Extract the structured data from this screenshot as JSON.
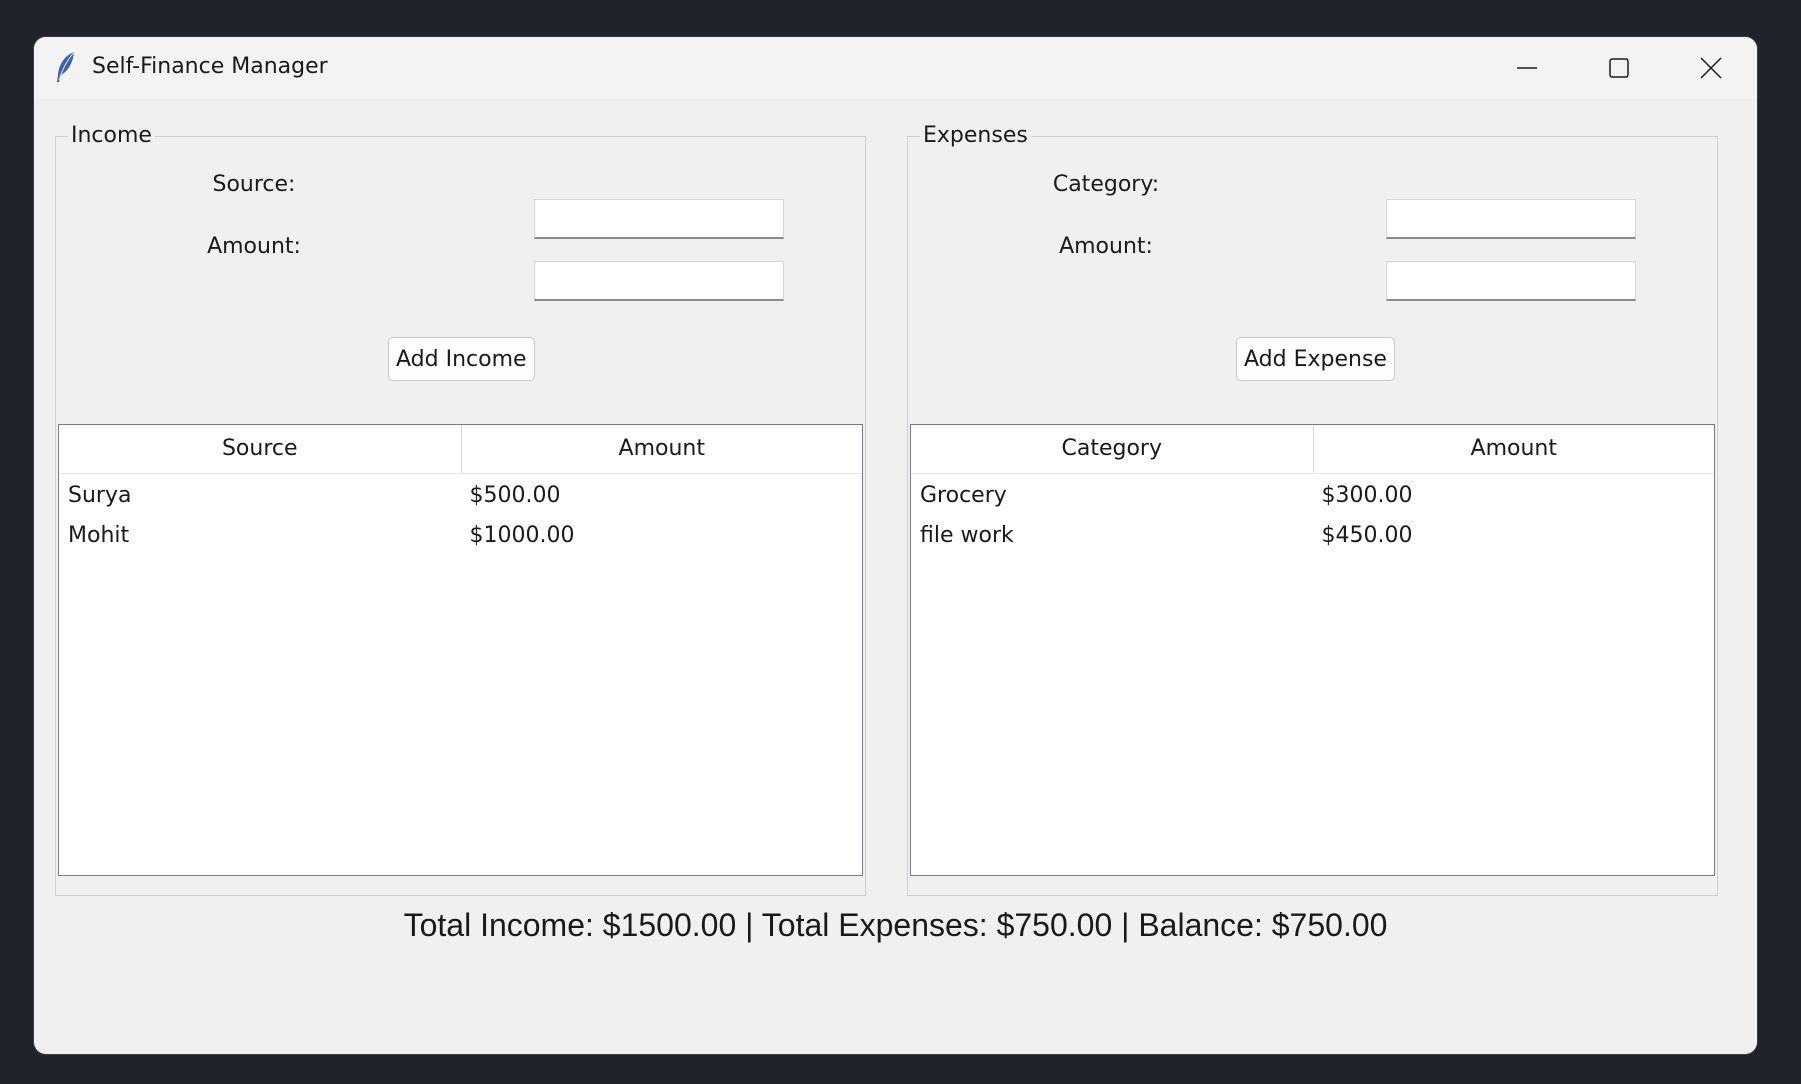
{
  "window": {
    "title": "Self-Finance Manager",
    "icon": "feather-icon",
    "controls": [
      "minimize-icon",
      "maximize-icon",
      "close-icon"
    ]
  },
  "income": {
    "group_title": "Income",
    "source_label": "Source:",
    "source_value": "",
    "amount_label": "Amount:",
    "amount_value": "",
    "add_button": "Add Income",
    "columns": [
      "Source",
      "Amount"
    ],
    "rows": [
      {
        "col1": "Surya",
        "col2": "$500.00"
      },
      {
        "col1": "Mohit",
        "col2": "$1000.00"
      }
    ]
  },
  "expenses": {
    "group_title": "Expenses",
    "category_label": "Category:",
    "category_value": "",
    "amount_label": "Amount:",
    "amount_value": "",
    "add_button": "Add Expense",
    "columns": [
      "Category",
      "Amount"
    ],
    "rows": [
      {
        "col1": "Grocery",
        "col2": "$300.00"
      },
      {
        "col1": "file work",
        "col2": "$450.00"
      }
    ]
  },
  "summary": {
    "text": "Total Income: $1500.00 | Total Expenses: $750.00 | Balance: $750.00"
  },
  "colors": {
    "desktop": "#20232a",
    "window_bg": "#f0f0f0",
    "tree_bg": "#ffffff"
  }
}
